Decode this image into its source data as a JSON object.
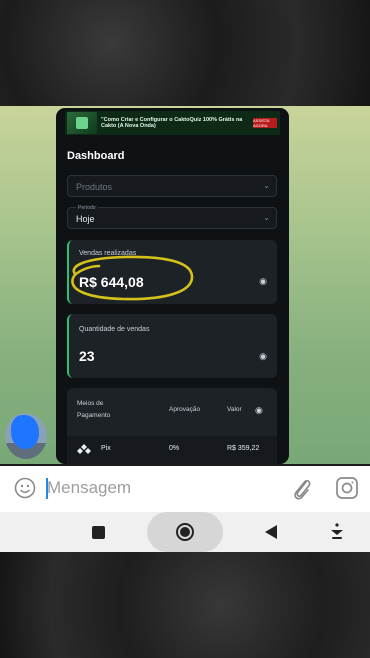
{
  "dashboard": {
    "banner_text": "\"Como Criar e Configurar o CaktoQuiz 100% Grátis na Cakto (A Nova Onda)",
    "banner_badge": "ASSISTA AGORA",
    "title": "Dashboard",
    "products_placeholder": "Produtos",
    "period_label": "Período",
    "period_value": "Hoje",
    "sales_label": "Vendas realizadas",
    "sales_value": "R$ 644,08",
    "count_label": "Quantidade de vendas",
    "count_value": "23",
    "table": {
      "col_method": "Meios de Pagamento",
      "col_approval": "Aprovação",
      "col_value": "Valor",
      "row_method": "Pix",
      "row_approval": "0%",
      "row_value": "R$ 359,22"
    }
  },
  "composer": {
    "placeholder": "Mensagem"
  },
  "colors": {
    "accent_green": "#2fbf71",
    "highlight_yellow": "#d4c21a",
    "caret_blue": "#1e88e5"
  },
  "icons": [
    "emoji-icon",
    "attach-icon",
    "instagram-icon",
    "stop-icon",
    "home-icon",
    "back-icon",
    "download-icon",
    "eye-icon",
    "pix-icon",
    "chevron-down-icon"
  ]
}
